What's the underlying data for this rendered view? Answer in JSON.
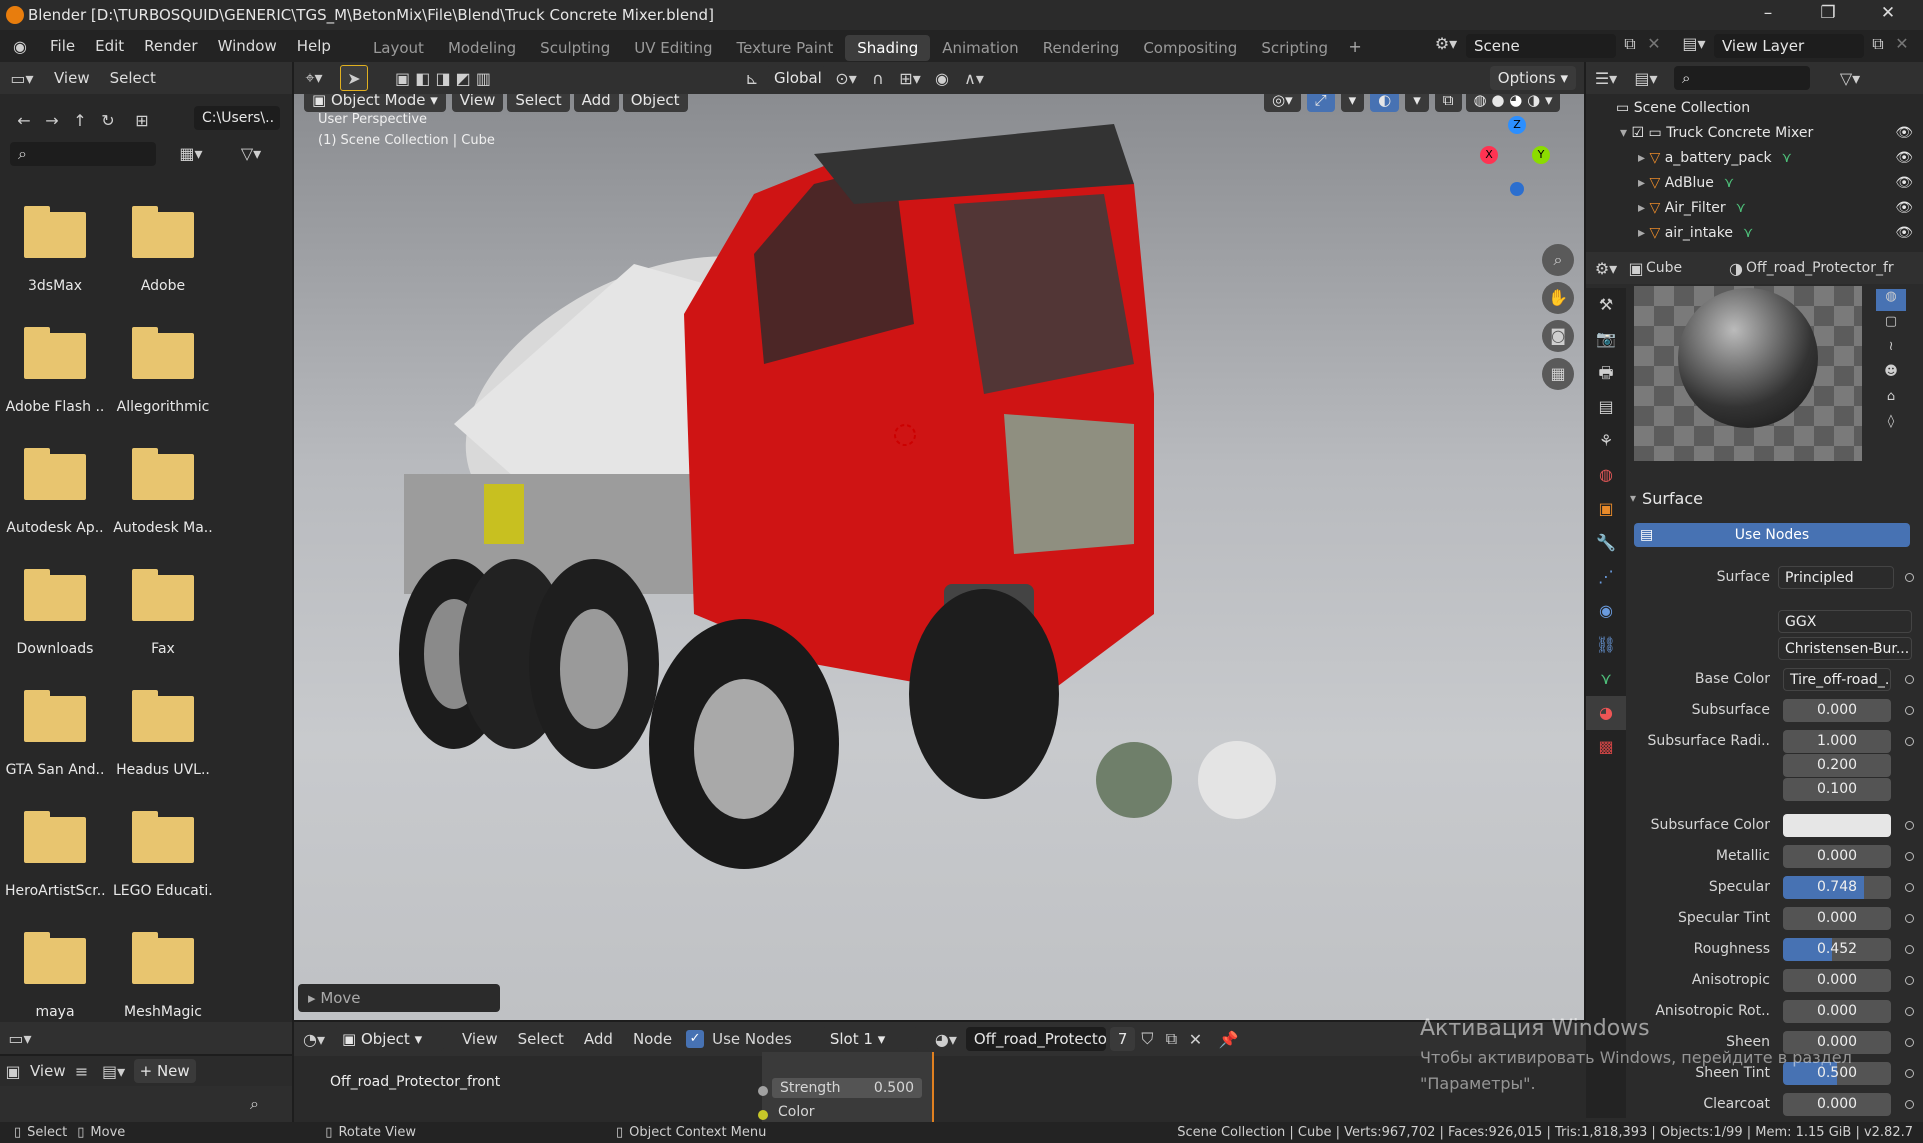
{
  "app": {
    "title": "Blender [D:\\TURBOSQUID\\GENERIC\\TGS_M\\BetonMix\\File\\Blend\\Truck Concrete Mixer.blend]"
  },
  "menu": [
    "File",
    "Edit",
    "Render",
    "Window",
    "Help"
  ],
  "workspaces": [
    {
      "label": "Layout",
      "active": false
    },
    {
      "label": "Modeling",
      "active": false
    },
    {
      "label": "Sculpting",
      "active": false
    },
    {
      "label": "UV Editing",
      "active": false
    },
    {
      "label": "Texture Paint",
      "active": false
    },
    {
      "label": "Shading",
      "active": true
    },
    {
      "label": "Animation",
      "active": false
    },
    {
      "label": "Rendering",
      "active": false
    },
    {
      "label": "Compositing",
      "active": false
    },
    {
      "label": "Scripting",
      "active": false
    }
  ],
  "scene": {
    "name": "Scene",
    "view_layer": "View Layer"
  },
  "filebrowser": {
    "header": {
      "view": "View",
      "select": "Select"
    },
    "path": "C:\\Users\\..",
    "folders": [
      "3dsMax",
      "Adobe",
      "Adobe Flash ..",
      "Allegorithmic",
      "Autodesk Ap..",
      "Autodesk Ma..",
      "Downloads",
      "Fax",
      "GTA San And..",
      "Headus UVL..",
      "HeroArtistScr..",
      "LEGO Educati..",
      "maya",
      "MeshMagic"
    ]
  },
  "viewport": {
    "header": {
      "transform": "Global",
      "options": "Options"
    },
    "mode": "Object Mode",
    "buttons": [
      "View",
      "Select",
      "Add",
      "Object"
    ],
    "overlay_line1": "User Perspective",
    "overlay_line2": "(1) Scene Collection | Cube",
    "gizmo": {
      "x": "X",
      "y": "Y",
      "z": "Z"
    },
    "operator": "Move"
  },
  "outliner": {
    "root": "Scene Collection",
    "collection": "Truck Concrete Mixer",
    "items": [
      "a_battery_pack",
      "AdBlue",
      "Air_Filter",
      "air_intake"
    ]
  },
  "properties": {
    "object": "Cube",
    "material": "Off_road_Protector_fr",
    "panel": "Surface",
    "use_nodes": "Use Nodes",
    "surface_label": "Surface",
    "surface_value": "Principled BSDF",
    "distribution": "GGX",
    "subsurface_method": "Christensen-Bur...",
    "rows": [
      {
        "label": "Base Color",
        "value": "Tire_off-road_...",
        "fill": 0
      },
      {
        "label": "Subsurface",
        "value": "0.000",
        "fill": 0
      },
      {
        "label": "Subsurface Radi..",
        "value": "1.000",
        "fill": 0
      },
      {
        "label": "",
        "value": "0.200",
        "fill": 0
      },
      {
        "label": "",
        "value": "0.100",
        "fill": 0
      },
      {
        "label": "Subsurface Color",
        "value": "",
        "fill": 0
      },
      {
        "label": "Metallic",
        "value": "0.000",
        "fill": 0
      },
      {
        "label": "Specular",
        "value": "0.748",
        "fill": 74.8
      },
      {
        "label": "Specular Tint",
        "value": "0.000",
        "fill": 0
      },
      {
        "label": "Roughness",
        "value": "0.452",
        "fill": 45.2
      },
      {
        "label": "Anisotropic",
        "value": "0.000",
        "fill": 0
      },
      {
        "label": "Anisotropic Rot..",
        "value": "0.000",
        "fill": 0
      },
      {
        "label": "Sheen",
        "value": "0.000",
        "fill": 0
      },
      {
        "label": "Sheen Tint",
        "value": "0.500",
        "fill": 50
      },
      {
        "label": "Clearcoat",
        "value": "0.000",
        "fill": 0
      }
    ]
  },
  "node_editor": {
    "object": "Object",
    "view": "View",
    "select": "Select",
    "add": "Add",
    "node": "Node",
    "use_nodes": "Use Nodes",
    "slot": "Slot 1",
    "material": "Off_road_Protector_f..",
    "users": "7",
    "node_title": "Off_road_Protector_front",
    "strength_label": "Strength",
    "strength_value": "0.500",
    "color_label": "Color"
  },
  "left_bottom": {
    "view": "View",
    "new": "New"
  },
  "watermark": {
    "line1": "Активация Windows",
    "line2": "Чтобы активировать Windows, перейдите в раздел",
    "line3": "\"Параметры\"."
  },
  "status": {
    "select": "Select",
    "move": "Move",
    "rotate": "Rotate View",
    "context": "Object Context Menu",
    "stats": "Scene Collection | Cube | Verts:967,702 | Faces:926,015 | Tris:1,818,393 | Objects:1/99 | Mem: 1.15 GiB | v2.82.7"
  }
}
